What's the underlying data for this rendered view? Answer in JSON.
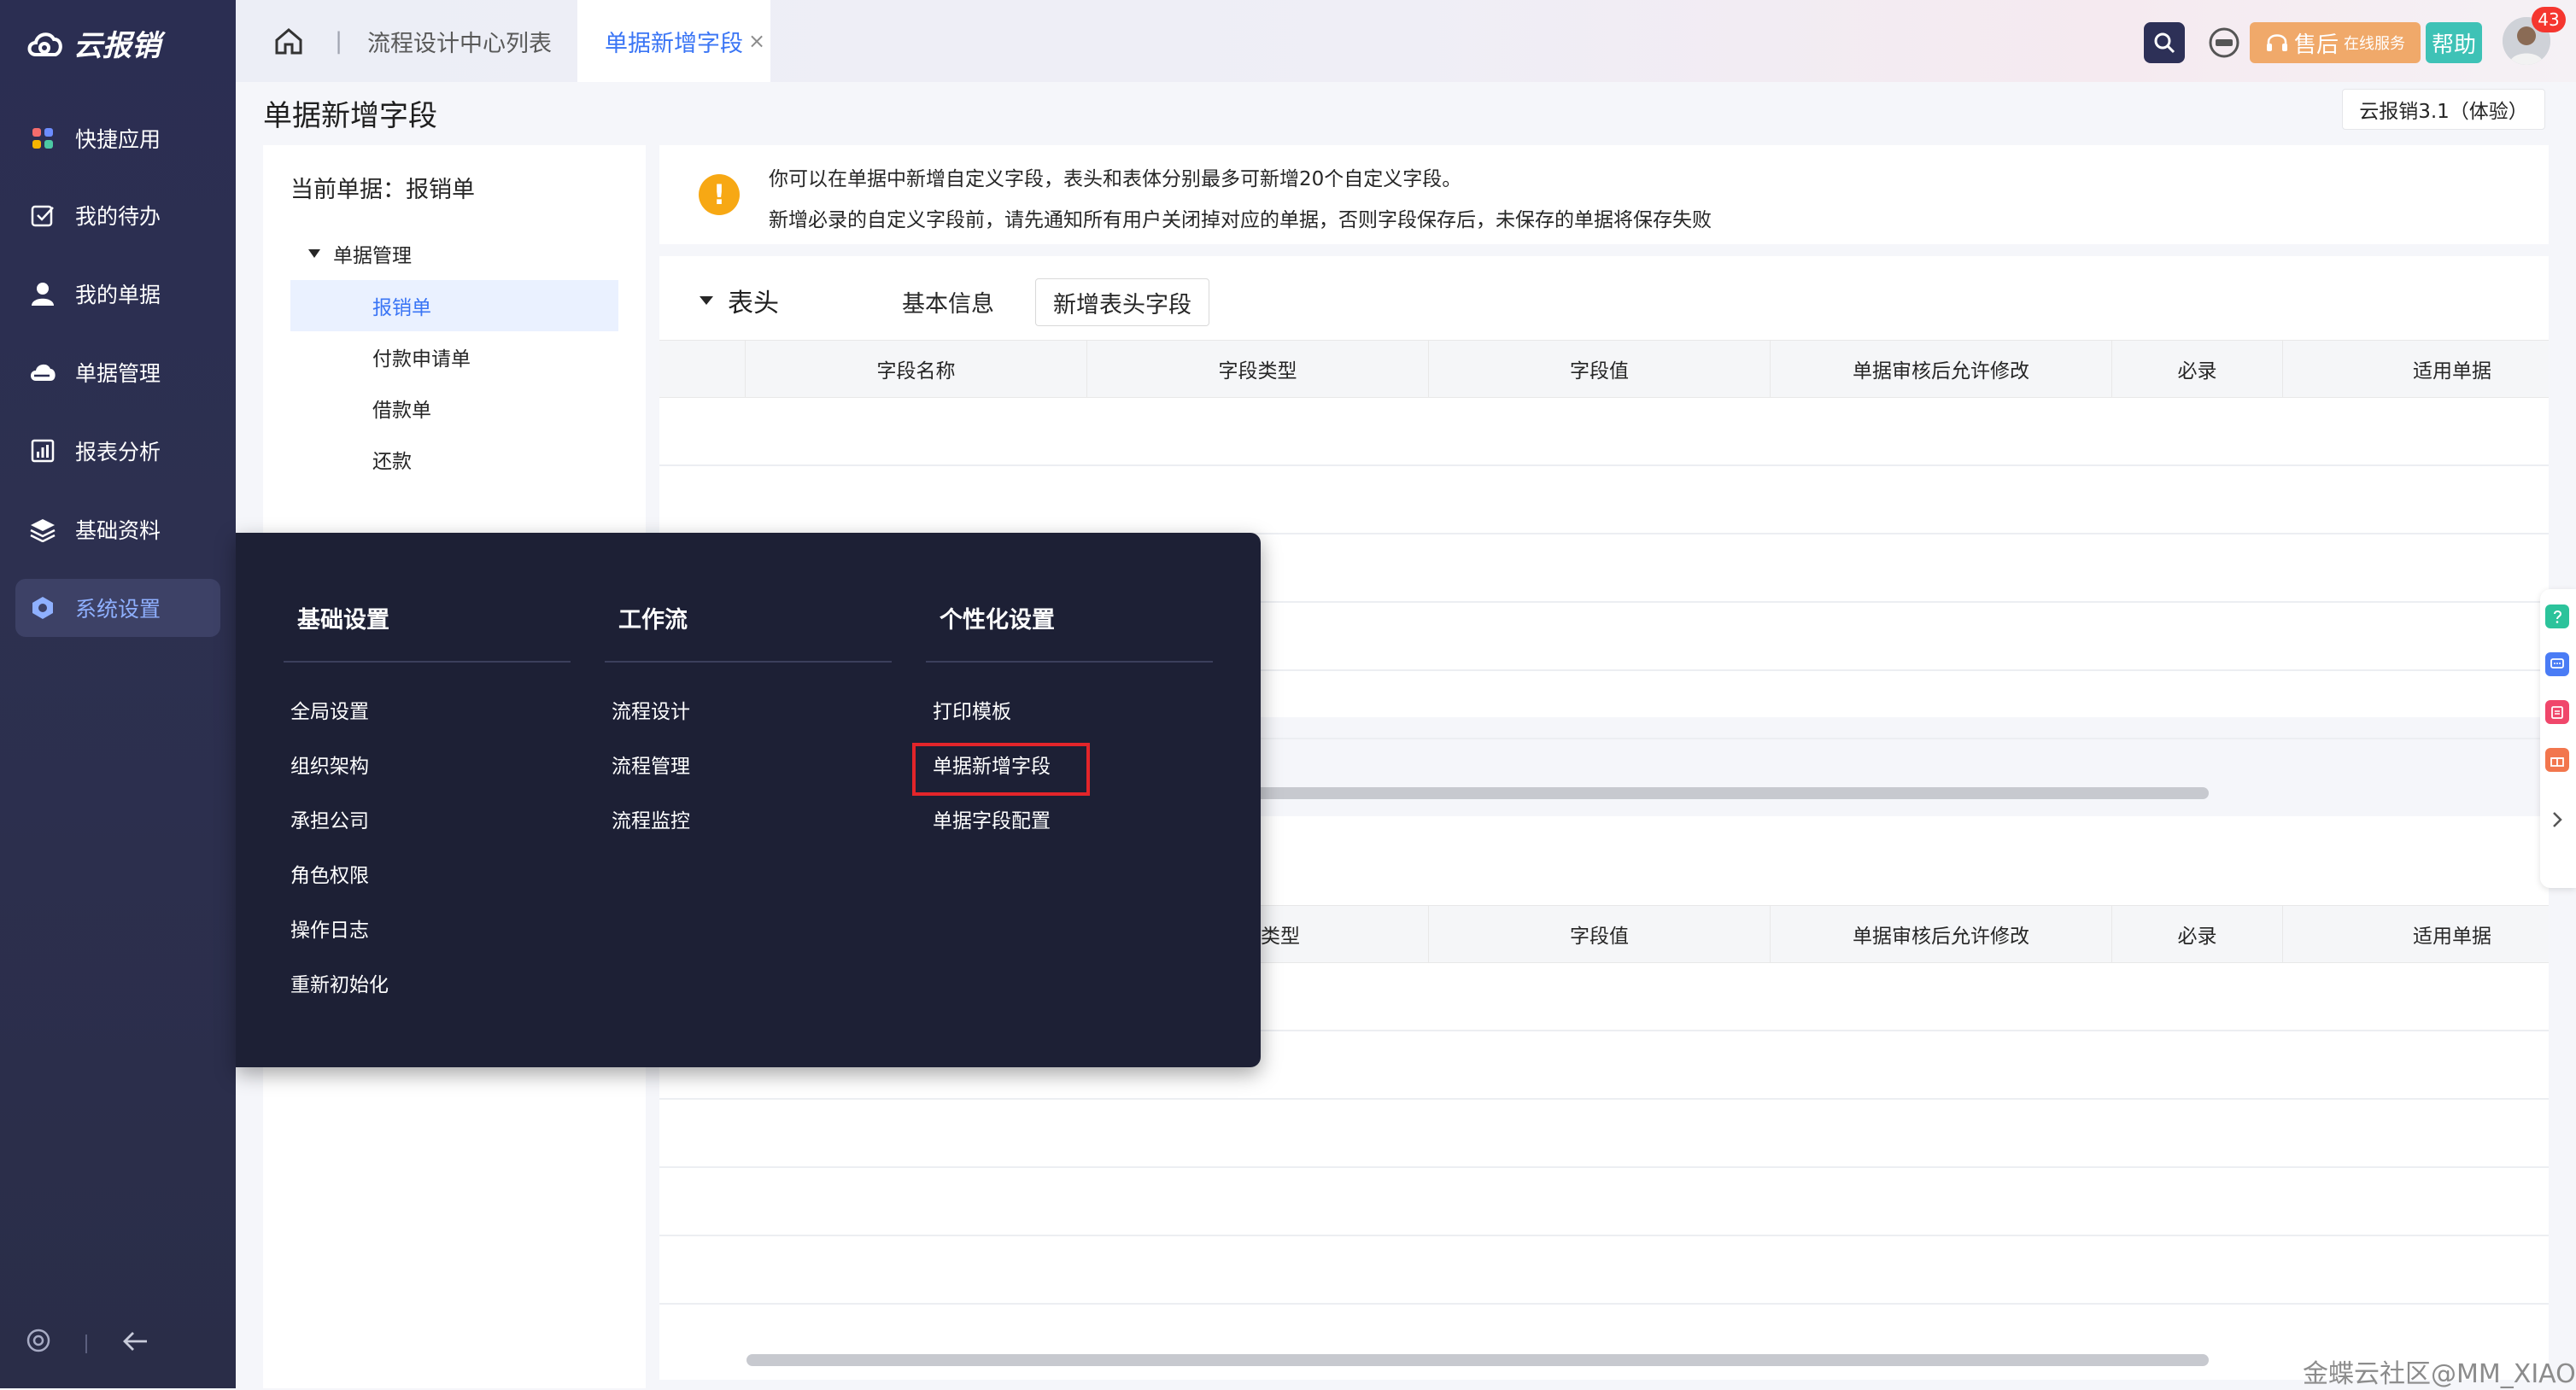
{
  "app": {
    "logo_text": "云报销",
    "brand_color": "#3a75f5"
  },
  "sidebar": {
    "items": [
      {
        "label": "快捷应用",
        "icon": "grid-apps-icon"
      },
      {
        "label": "我的待办",
        "icon": "checkbox-icon"
      },
      {
        "label": "我的单据",
        "icon": "user-icon"
      },
      {
        "label": "单据管理",
        "icon": "cloud-icon"
      },
      {
        "label": "报表分析",
        "icon": "chart-icon"
      },
      {
        "label": "基础资料",
        "icon": "layers-icon"
      },
      {
        "label": "系统设置",
        "icon": "hexagon-settings-icon",
        "active": true
      }
    ]
  },
  "tabs": {
    "list_tab": "流程设计中心列表",
    "active_tab": "单据新增字段",
    "close_glyph": "×",
    "separator": "|"
  },
  "header": {
    "service_label": "售后",
    "service_sub": "在线服务",
    "help_label": "帮助",
    "badge_count": "43"
  },
  "page": {
    "title": "单据新增字段",
    "version": "云报销3.1（体验）"
  },
  "doc_tree": {
    "current_label": "当前单据：报销单",
    "root": "单据管理",
    "children": [
      "报销单",
      "付款申请单",
      "借款单",
      "还款"
    ]
  },
  "notice": {
    "line1": "你可以在单据中新增自定义字段，表头和表体分别最多可新增20个自定义字段。",
    "line2": "新增必录的自定义字段前，请先通知所有用户关闭掉对应的单据，否则字段保存后，未保存的单据将保存失败"
  },
  "header_section": {
    "title": "表头",
    "basic_info": "基本信息",
    "add_button": "新增表头字段",
    "columns": [
      "字段名称",
      "字段类型",
      "字段值",
      "单据审核后允许修改",
      "必录",
      "适用单据"
    ]
  },
  "body_section": {
    "columns": [
      "类型",
      "字段值",
      "单据审核后允许修改",
      "必录",
      "适用单据"
    ]
  },
  "menu": {
    "columns": [
      {
        "title": "基础设置",
        "items": [
          "全局设置",
          "组织架构",
          "承担公司",
          "角色权限",
          "操作日志",
          "重新初始化"
        ]
      },
      {
        "title": "工作流",
        "items": [
          "流程设计",
          "流程管理",
          "流程监控"
        ]
      },
      {
        "title": "个性化设置",
        "items": [
          "打印模板",
          "单据新增字段",
          "单据字段配置"
        ]
      }
    ]
  },
  "watermark": "金蝶云社区@MM_XIAO"
}
